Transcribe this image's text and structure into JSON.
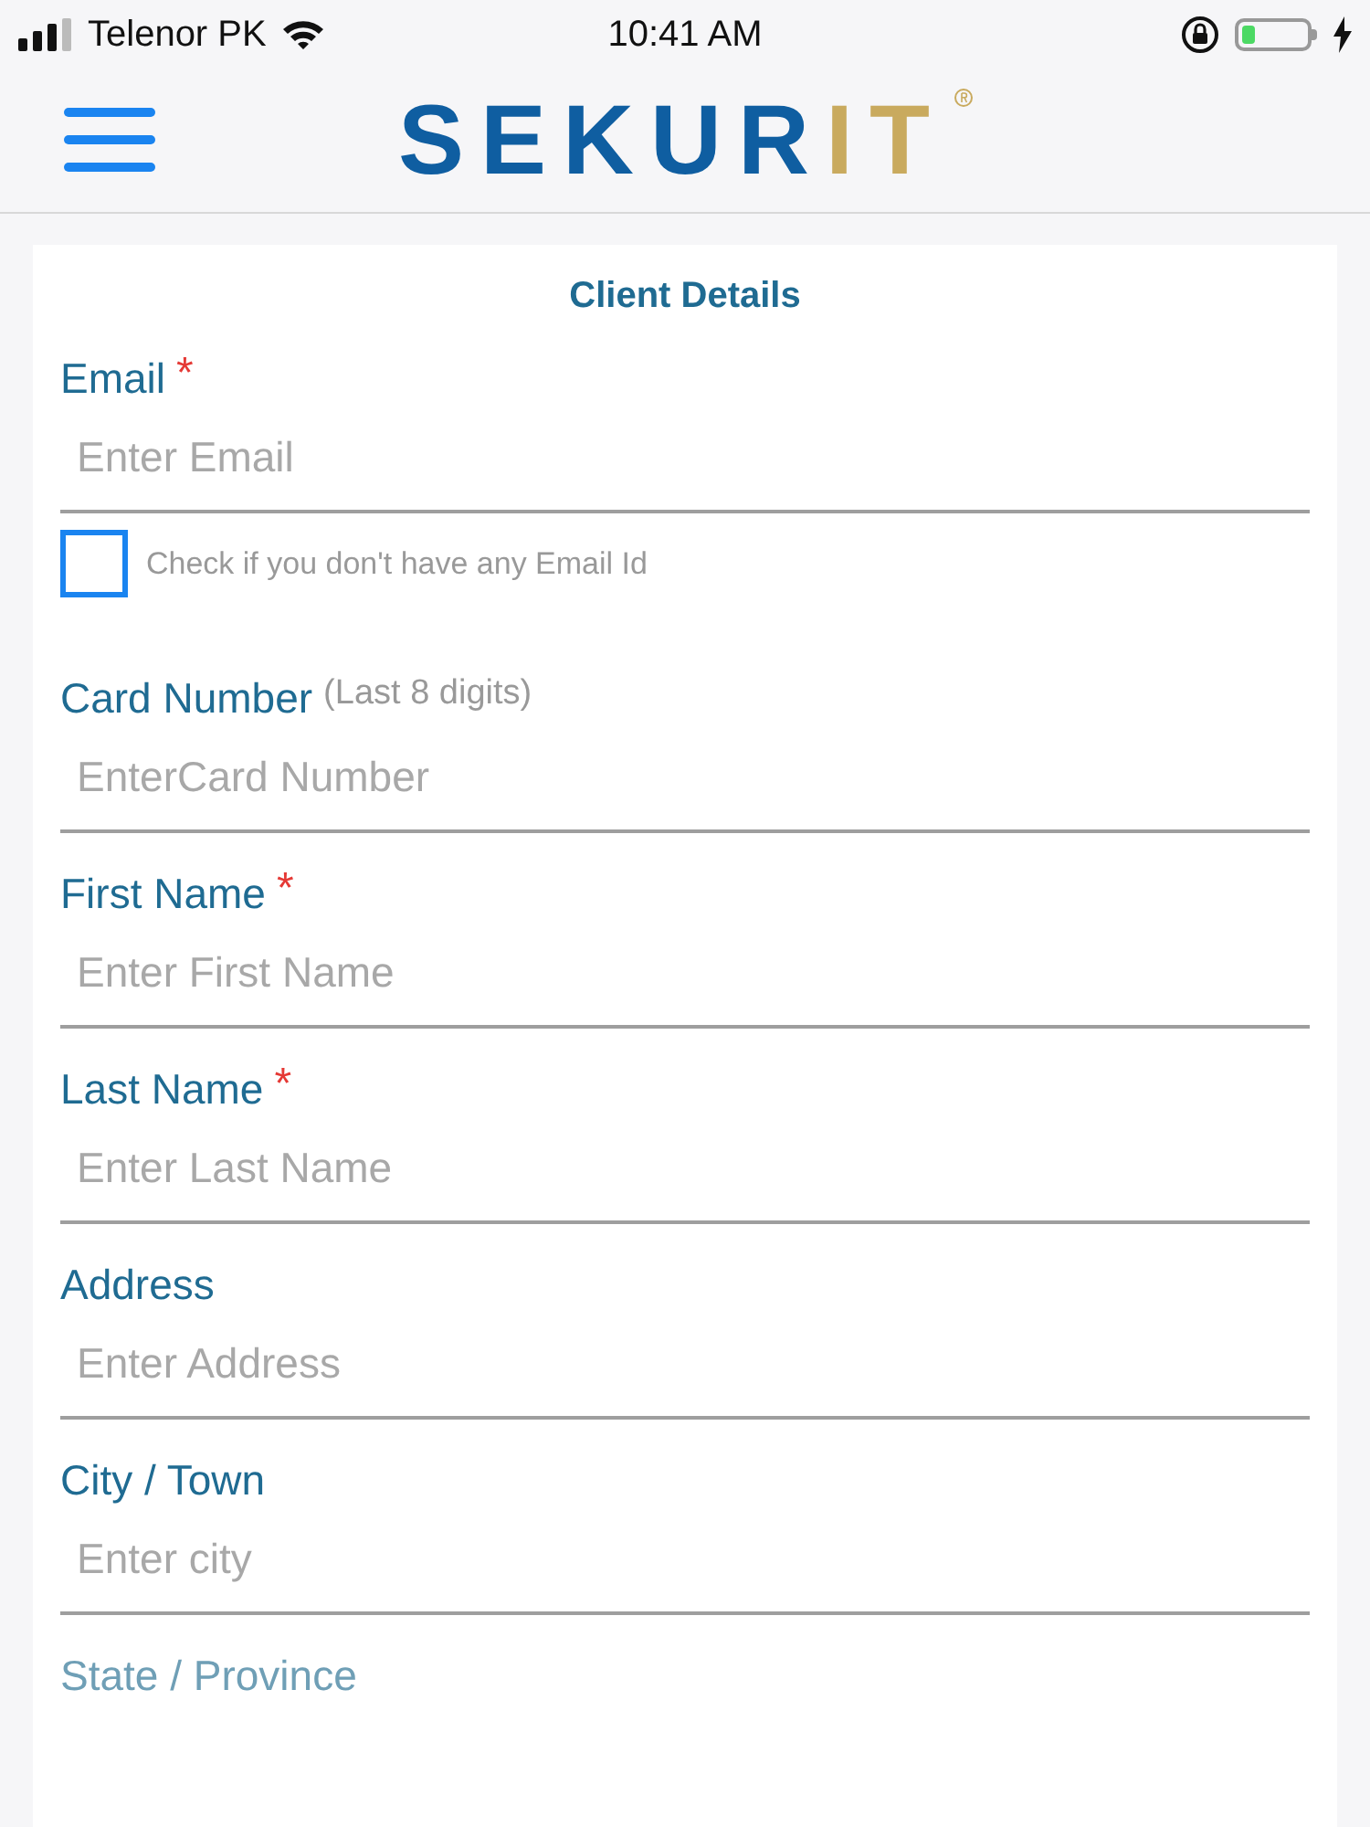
{
  "status_bar": {
    "carrier": "Telenor PK",
    "time": "10:41 AM"
  },
  "header": {
    "logo": [
      "SEKUR",
      "IT"
    ]
  },
  "form": {
    "title": "Client Details",
    "fields": [
      {
        "label": "Email",
        "required_mark": "*",
        "placeholder": "Enter Email",
        "checkbox": {
          "label": "Check if you don't have any Email Id",
          "checked": false
        }
      },
      {
        "label": "Card Number",
        "hint": "(Last 8 digits)",
        "placeholder": "EnterCard Number"
      },
      {
        "label": "First Name",
        "required_mark": "*",
        "placeholder": "Enter First Name"
      },
      {
        "label": "Last Name",
        "required_mark": "*",
        "placeholder": "Enter Last Name"
      },
      {
        "label": "Address",
        "placeholder": "Enter Address"
      },
      {
        "label": "City / Town",
        "placeholder": "Enter city"
      },
      {
        "label": "State / Province"
      }
    ]
  }
}
